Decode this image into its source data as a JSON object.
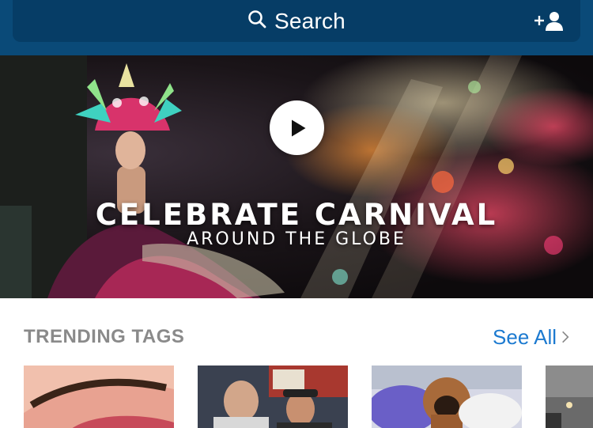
{
  "header": {
    "search_label": "Search",
    "search_icon": "search-icon",
    "add_friend_icon": "add-person-icon",
    "colors": {
      "bar": "#0a4a78",
      "search_field": "#063d66"
    }
  },
  "hero": {
    "title": "CELEBRATE CARNIVAL",
    "subtitle": "AROUND THE GLOBE",
    "play_icon": "play-icon"
  },
  "trending": {
    "title": "TRENDING TAGS",
    "see_all_label": "See All",
    "see_all_icon": "chevron-right-icon",
    "accent": "#1c7ad0",
    "thumbnails": [
      {
        "subject": "eye-makeup"
      },
      {
        "subject": "sports-fans"
      },
      {
        "subject": "dog-on-bed"
      },
      {
        "subject": "partial"
      }
    ]
  }
}
